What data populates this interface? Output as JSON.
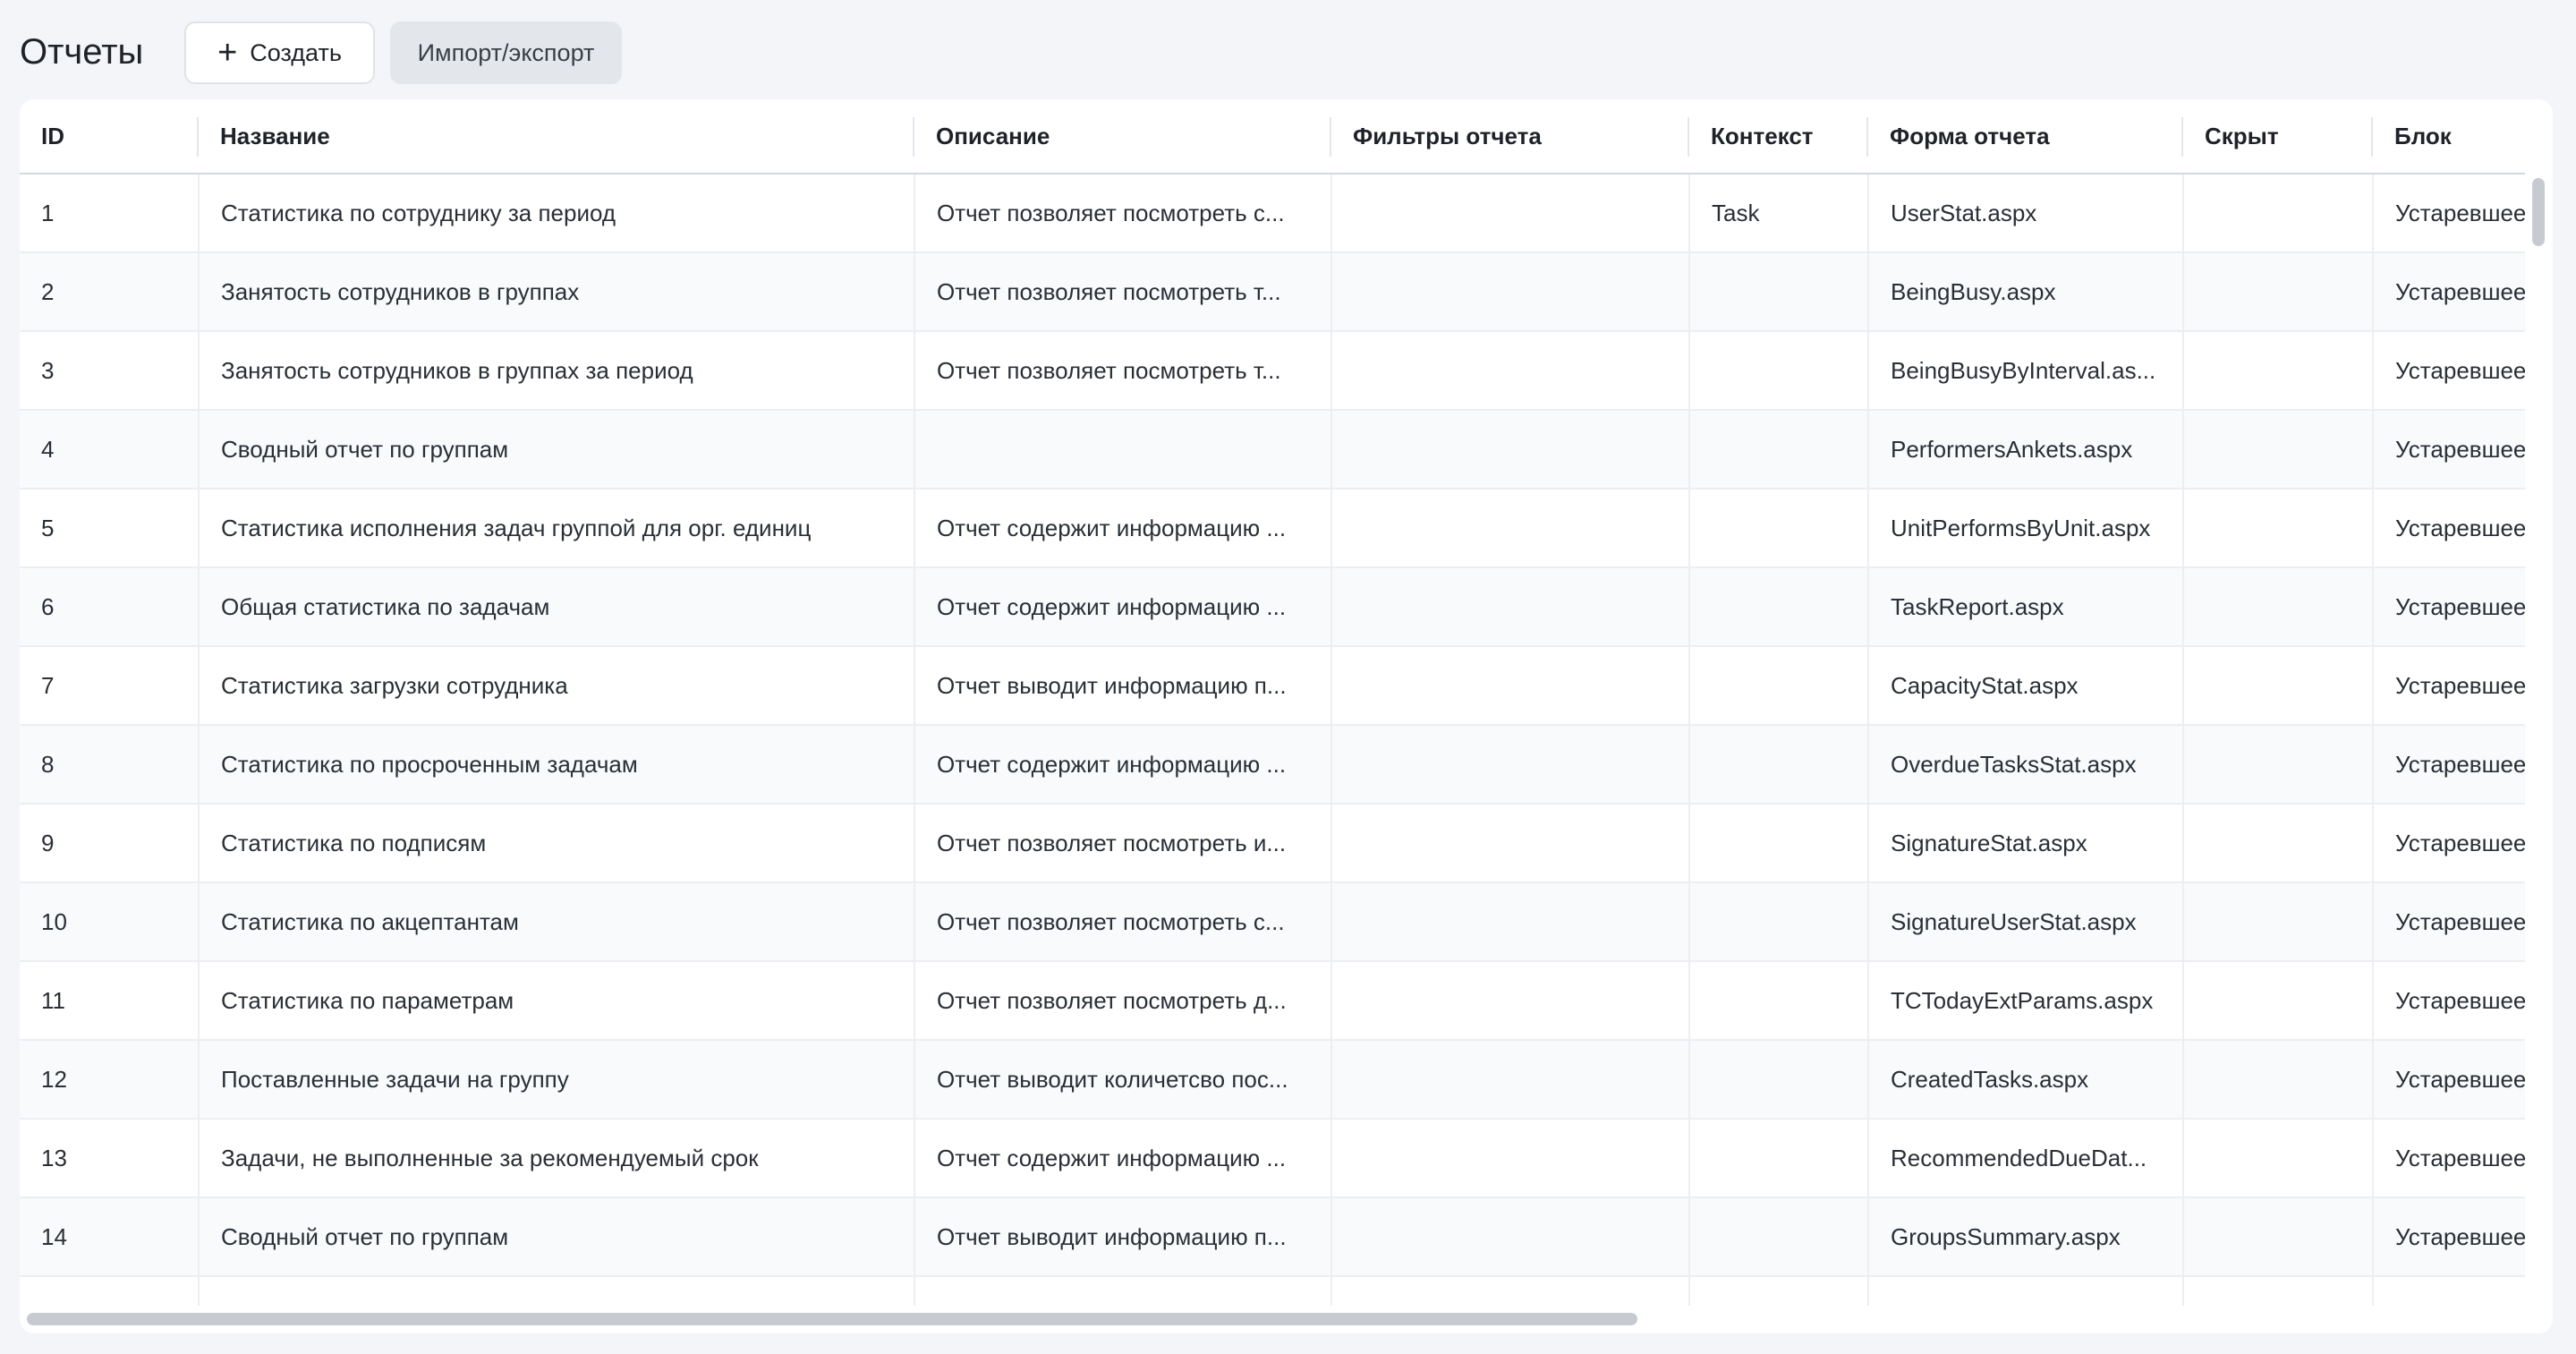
{
  "header": {
    "title": "Отчеты",
    "create_label": "Создать",
    "create_icon": "plus-icon",
    "import_export_label": "Импорт/экспорт"
  },
  "table": {
    "columns": [
      {
        "key": "id",
        "label": "ID"
      },
      {
        "key": "name",
        "label": "Название"
      },
      {
        "key": "description",
        "label": "Описание"
      },
      {
        "key": "filters",
        "label": "Фильтры отчета"
      },
      {
        "key": "context",
        "label": "Контекст"
      },
      {
        "key": "form",
        "label": "Форма отчета"
      },
      {
        "key": "hidden",
        "label": "Скрыт"
      },
      {
        "key": "block",
        "label": "Блок"
      }
    ],
    "rows": [
      {
        "id": "1",
        "name": "Статистика по сотруднику за период",
        "description": "Отчет позволяет посмотреть с...",
        "filters": "",
        "context": "Task",
        "form": "UserStat.aspx",
        "hidden": "",
        "block": "Устаревшее"
      },
      {
        "id": "2",
        "name": "Занятость сотрудников в группах",
        "description": "Отчет позволяет посмотреть т...",
        "filters": "",
        "context": "",
        "form": "BeingBusy.aspx",
        "hidden": "",
        "block": "Устаревшее"
      },
      {
        "id": "3",
        "name": "Занятость сотрудников в группах за период",
        "description": "Отчет позволяет посмотреть т...",
        "filters": "",
        "context": "",
        "form": "BeingBusyByInterval.as...",
        "hidden": "",
        "block": "Устаревшее"
      },
      {
        "id": "4",
        "name": "Сводный отчет по группам",
        "description": "",
        "filters": "",
        "context": "",
        "form": "PerformersAnkets.aspx",
        "hidden": "",
        "block": "Устаревшее"
      },
      {
        "id": "5",
        "name": "Статистика исполнения задач группой для орг. единиц",
        "description": "Отчет содержит информацию ...",
        "filters": "",
        "context": "",
        "form": "UnitPerformsByUnit.aspx",
        "hidden": "",
        "block": "Устаревшее"
      },
      {
        "id": "6",
        "name": "Общая статистика по задачам",
        "description": "Отчет содержит информацию ...",
        "filters": "",
        "context": "",
        "form": "TaskReport.aspx",
        "hidden": "",
        "block": "Устаревшее"
      },
      {
        "id": "7",
        "name": "Статистика загрузки сотрудника",
        "description": "Отчет выводит информацию п...",
        "filters": "",
        "context": "",
        "form": "CapacityStat.aspx",
        "hidden": "",
        "block": "Устаревшее"
      },
      {
        "id": "8",
        "name": "Статистика по просроченным задачам",
        "description": "Отчет содержит информацию ...",
        "filters": "",
        "context": "",
        "form": "OverdueTasksStat.aspx",
        "hidden": "",
        "block": "Устаревшее"
      },
      {
        "id": "9",
        "name": "Статистика по подписям",
        "description": "Отчет позволяет посмотреть и...",
        "filters": "",
        "context": "",
        "form": "SignatureStat.aspx",
        "hidden": "",
        "block": "Устаревшее"
      },
      {
        "id": "10",
        "name": "Статистика по акцептантам",
        "description": "Отчет позволяет посмотреть с...",
        "filters": "",
        "context": "",
        "form": "SignatureUserStat.aspx",
        "hidden": "",
        "block": "Устаревшее"
      },
      {
        "id": "11",
        "name": "Статистика по параметрам",
        "description": "Отчет позволяет посмотреть д...",
        "filters": "",
        "context": "",
        "form": "TCTodayExtParams.aspx",
        "hidden": "",
        "block": "Устаревшее"
      },
      {
        "id": "12",
        "name": "Поставленные задачи на группу",
        "description": "Отчет выводит количетсво пос...",
        "filters": "",
        "context": "",
        "form": "CreatedTasks.aspx",
        "hidden": "",
        "block": "Устаревшее"
      },
      {
        "id": "13",
        "name": "Задачи, не выполненные за рекомендуемый срок",
        "description": "Отчет содержит информацию ...",
        "filters": "",
        "context": "",
        "form": "RecommendedDueDat...",
        "hidden": "",
        "block": "Устаревшее"
      },
      {
        "id": "14",
        "name": "Сводный отчет по группам",
        "description": "Отчет выводит информацию п...",
        "filters": "",
        "context": "",
        "form": "GroupsSummary.aspx",
        "hidden": "",
        "block": "Устаревшее"
      },
      {
        "id": "",
        "name": "",
        "description": "",
        "filters": "",
        "context": "",
        "form": "",
        "hidden": "",
        "block": ""
      }
    ]
  }
}
